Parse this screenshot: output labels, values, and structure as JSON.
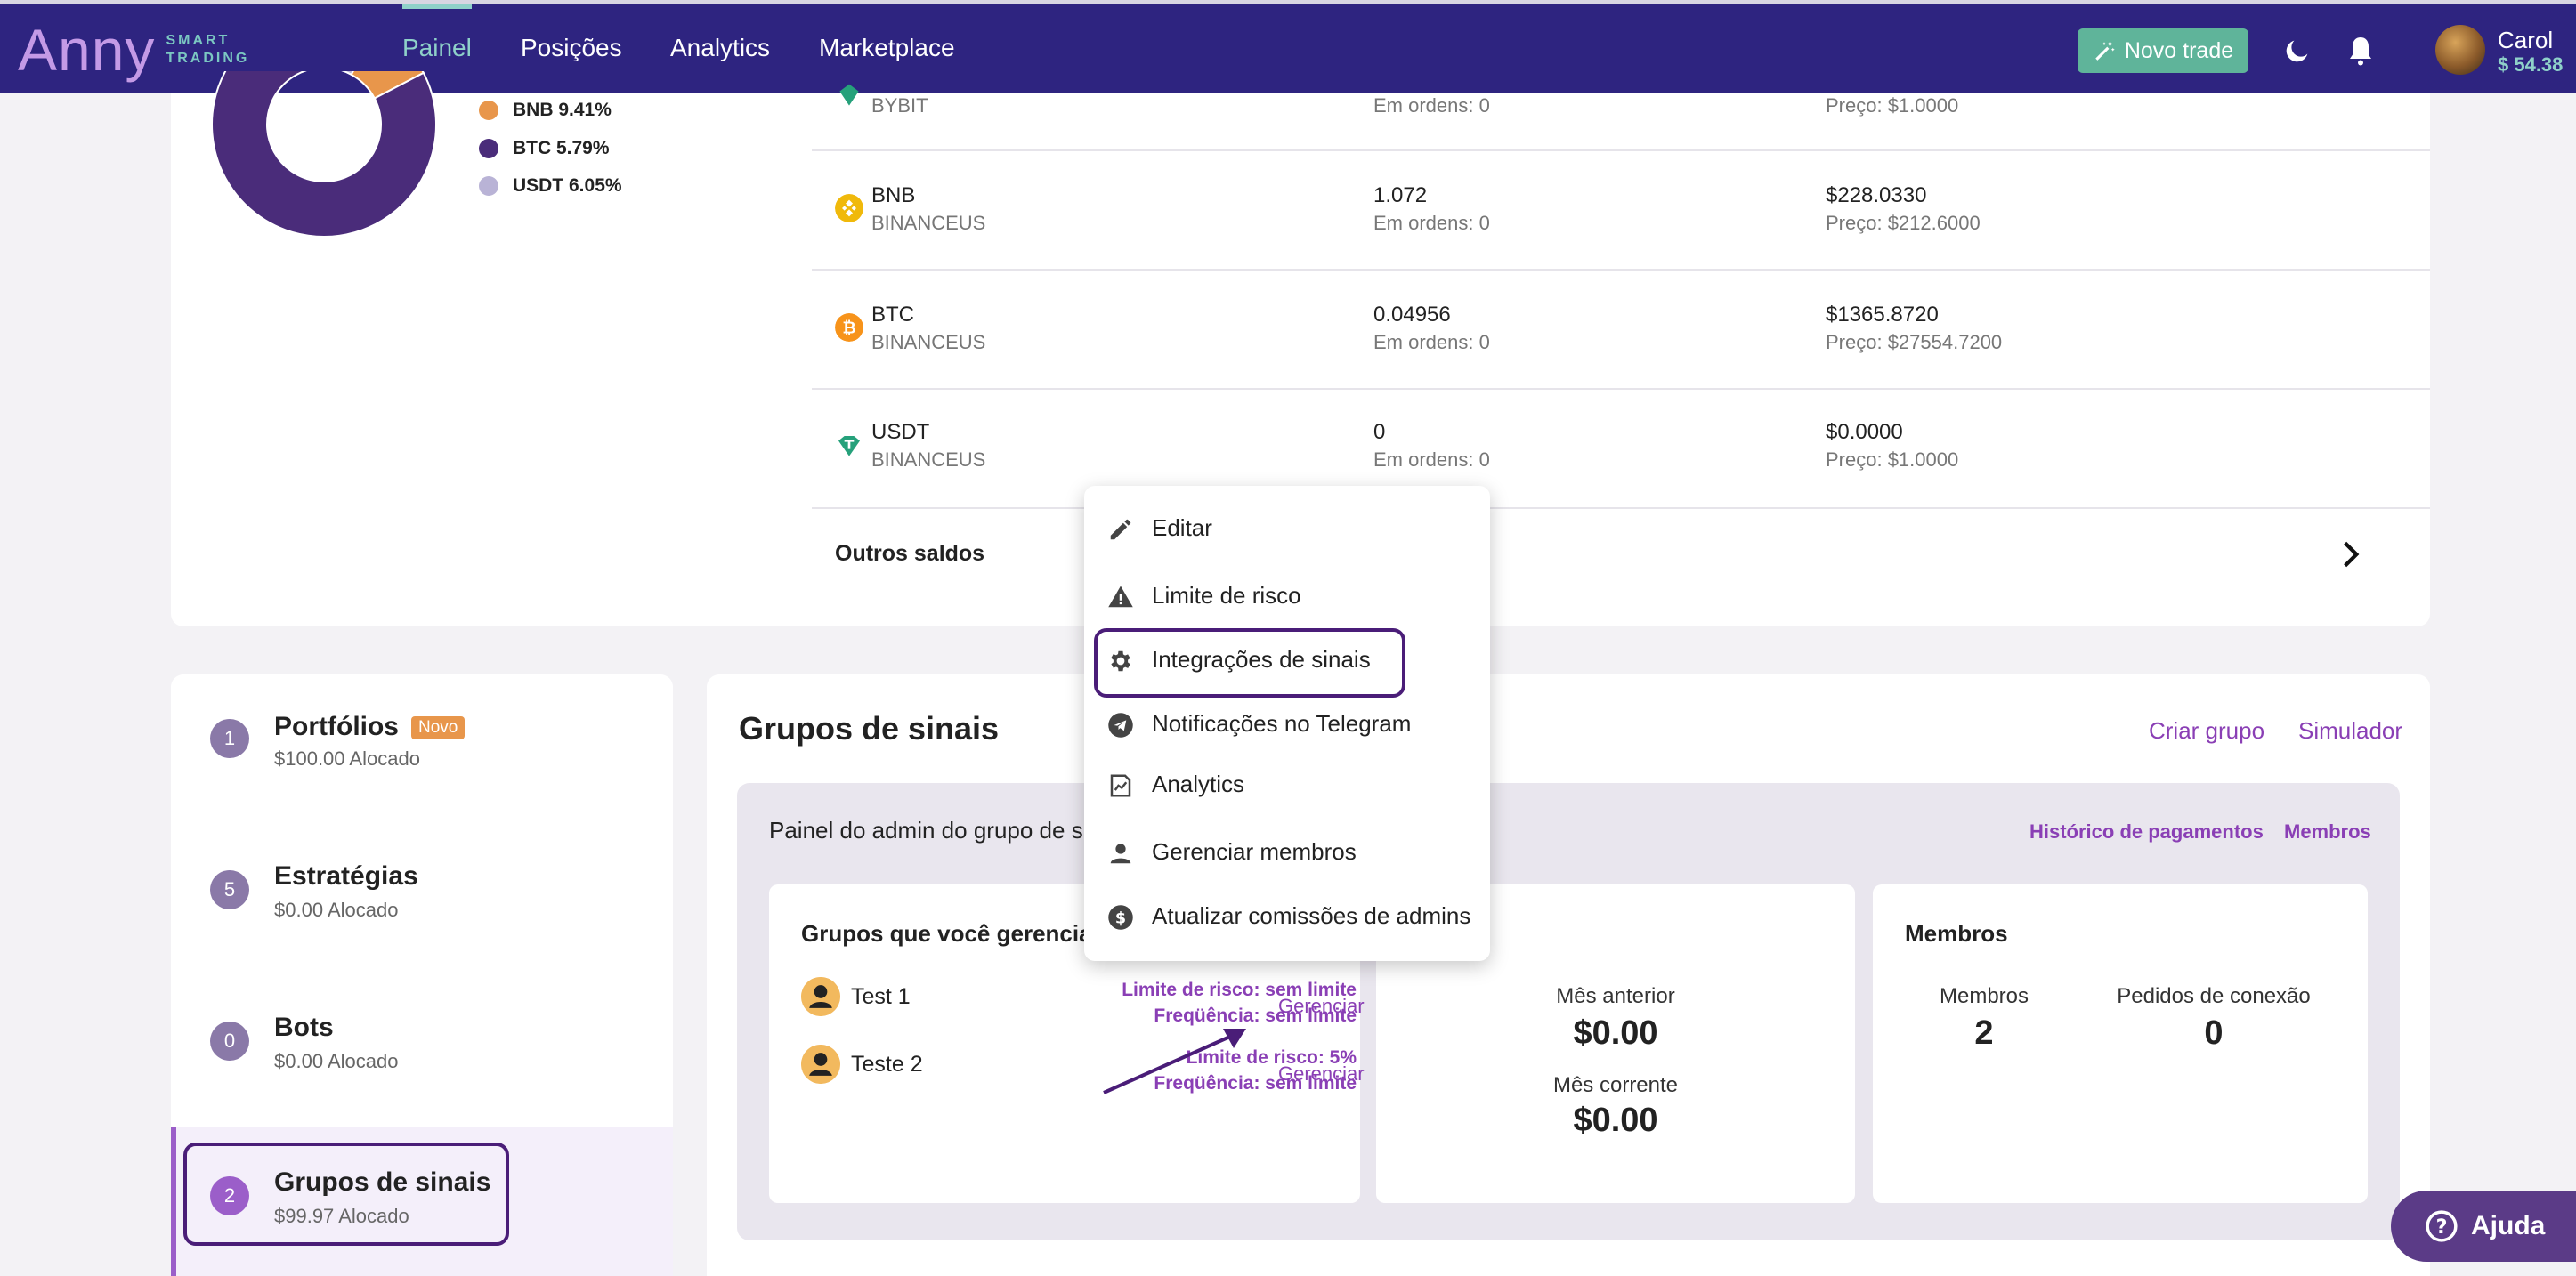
{
  "nav": {
    "logo_text": "Anny",
    "logo_sub": "SMART TRADING",
    "items": [
      {
        "label": "Painel",
        "active": true
      },
      {
        "label": "Posições",
        "active": false
      },
      {
        "label": "Analytics",
        "active": false
      },
      {
        "label": "Marketplace",
        "active": false
      }
    ],
    "new_trade": "Novo trade",
    "user_name": "Carol",
    "user_balance": "$ 54.38",
    "icons": [
      "magic-wand-icon",
      "moon-icon",
      "bell-icon"
    ]
  },
  "portfolio_chart": {
    "type": "pie",
    "legend": [
      {
        "label": "BNB 9.41%",
        "color": "#e8964b"
      },
      {
        "label": "BTC 5.79%",
        "color": "#4a2c7a"
      },
      {
        "label": "USDT 6.05%",
        "color": "#b9b3d6"
      }
    ]
  },
  "chart_data": {
    "type": "pie",
    "slices": [
      {
        "label": "BNB",
        "value": 9.41,
        "color": "#e8964b"
      },
      {
        "label": "BTC",
        "value": 5.79,
        "color": "#4a2c7a"
      },
      {
        "label": "USDT",
        "value": 6.05,
        "color": "#b9b3d6"
      }
    ]
  },
  "assets": [
    {
      "name": "",
      "exchange": "BYBIT",
      "qty": "",
      "orders": "Em ordens: 0",
      "value": "",
      "price": "Preço: $1.0000",
      "icon": "usdt-icon",
      "color": "#26a17b"
    },
    {
      "name": "BNB",
      "exchange": "BINANCEUS",
      "qty": "1.072",
      "orders": "Em ordens: 0",
      "value": "$228.0330",
      "price": "Preço: $212.6000",
      "icon": "bnb-icon",
      "color": "#f0b90b"
    },
    {
      "name": "BTC",
      "exchange": "BINANCEUS",
      "qty": "0.04956",
      "orders": "Em ordens: 0",
      "value": "$1365.8720",
      "price": "Preço: $27554.7200",
      "icon": "btc-icon",
      "color": "#f7931a"
    },
    {
      "name": "USDT",
      "exchange": "BINANCEUS",
      "qty": "0",
      "orders": "Em ordens: 0",
      "value": "$0.0000",
      "price": "Preço: $1.0000",
      "icon": "usdt-icon",
      "color": "#26a17b"
    }
  ],
  "others_label": "Outros saldos",
  "sidebar": [
    {
      "num": "1",
      "title": "Portfólios",
      "badge": "Novo",
      "sub": "$100.00 Alocado"
    },
    {
      "num": "5",
      "title": "Estratégias",
      "badge": "",
      "sub": "$0.00 Alocado"
    },
    {
      "num": "0",
      "title": "Bots",
      "badge": "",
      "sub": "$0.00 Alocado"
    },
    {
      "num": "2",
      "title": "Grupos de sinais",
      "badge": "",
      "sub": "$99.97 Alocado"
    }
  ],
  "main": {
    "title": "Grupos de sinais",
    "create_group": "Criar grupo",
    "simulator": "Simulador",
    "admin_title": "Painel do admin do grupo de sinais",
    "payment_history": "Histórico de pagamentos",
    "members_link": "Membros",
    "managed": {
      "title": "Grupos que você gerencia",
      "groups": [
        {
          "name": "Test 1",
          "limit": "Limite de risco: sem limite",
          "freq": "Freqüência: sem limite",
          "manage": "Gerenciar"
        },
        {
          "name": "Teste 2",
          "limit": "Limite de risco: 5%",
          "freq": "Freqüência: sem limite",
          "manage": "Gerenciar"
        }
      ]
    },
    "revenue": {
      "prev_label": "Mês anterior",
      "prev_value": "$0.00",
      "curr_label": "Mês corrente",
      "curr_value": "$0.00"
    },
    "members": {
      "title": "Membros",
      "members_label": "Membros",
      "members_value": "2",
      "requests_label": "Pedidos de conexão",
      "requests_value": "0"
    }
  },
  "menu": [
    {
      "label": "Editar",
      "icon": "pencil-icon"
    },
    {
      "label": "Limite de risco",
      "icon": "warning-icon"
    },
    {
      "label": "Integrações de sinais",
      "icon": "gear-icon"
    },
    {
      "label": "Notificações no Telegram",
      "icon": "telegram-icon"
    },
    {
      "label": "Analytics",
      "icon": "analytics-icon"
    },
    {
      "label": "Gerenciar membros",
      "icon": "person-icon"
    },
    {
      "label": "Atualizar comissões de admins",
      "icon": "dollar-icon"
    }
  ],
  "help": "Ajuda"
}
